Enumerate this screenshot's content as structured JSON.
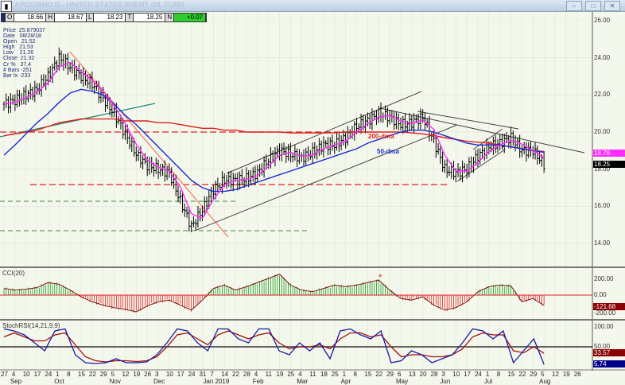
{
  "window": {
    "title": "APCO/BNO.D - UNITED STATES BRENT OIL FUND",
    "buttons": [
      "–",
      "□",
      "✕"
    ]
  },
  "ohlc_bar": {
    "o_label": "O",
    "o": "18.66",
    "h_label": "H",
    "h": "18.67",
    "l_label": "L",
    "l": "18.23",
    "t_label": "T",
    "t": "18.25",
    "n_label": "N",
    "n": "+0.07",
    "change_color": "#2ecc2e"
  },
  "info_panel": [
    "Price  25.879037",
    "Date   08/28/18",
    "Open   21.52",
    "High   21.53",
    "Low    21.26",
    "Close  21.32",
    "Cr %   37.4",
    "# Bars -251",
    "Bar Ix -233"
  ],
  "annotations": {
    "ma200": "200-dma",
    "ma50": "50-dma"
  },
  "price_axis": {
    "labels": [
      "26.00",
      "24.00",
      "22.00",
      "20.00",
      "18.00",
      "16.00",
      "14.00"
    ],
    "tag_ma": "18.78",
    "tag_price": "18.25"
  },
  "cci_panel": {
    "title": "CCI(20)",
    "labels": [
      "200.00",
      "0.00",
      "-200.00"
    ],
    "tag": "-121.68"
  },
  "stoch_panel": {
    "title": "StochRSI(14,21,9,9)",
    "labels": [
      "100.00",
      "50.00"
    ],
    "tag_signal": "33.57",
    "tag_k": "5.74"
  },
  "date_axis": {
    "days": [
      "27",
      "4",
      "10",
      "17",
      "24",
      "1",
      "8",
      "15",
      "22",
      "29",
      "5",
      "12",
      "19",
      "26",
      "3",
      "10",
      "17",
      "24",
      "31",
      "7",
      "14",
      "22",
      "28",
      "4",
      "11",
      "19",
      "25",
      "4",
      "11",
      "18",
      "25",
      "1",
      "8",
      "15",
      "22",
      "29",
      "6",
      "13",
      "20",
      "28",
      "3",
      "10",
      "17",
      "24",
      "1",
      "8",
      "15",
      "22",
      "29",
      "5",
      "12",
      "19",
      "26"
    ],
    "months": [
      {
        "label": "Sep",
        "week": 1
      },
      {
        "label": "Oct",
        "week": 5
      },
      {
        "label": "Nov",
        "week": 10
      },
      {
        "label": "Dec",
        "week": 14
      },
      {
        "label": "Jan 2019",
        "week": 18.5
      },
      {
        "label": "Feb",
        "week": 23
      },
      {
        "label": "Mar",
        "week": 27
      },
      {
        "label": "Apr",
        "week": 31
      },
      {
        "label": "May",
        "week": 36
      },
      {
        "label": "Jun",
        "week": 40
      },
      {
        "label": "Jul",
        "week": 44
      },
      {
        "label": "Aug",
        "week": 49
      }
    ]
  },
  "chart_data": {
    "type": "line",
    "title": "United States Brent Oil Fund (BNO) daily",
    "x_unit": "week index from 2018-08-27",
    "ylim": [
      13,
      26.6
    ],
    "close": [
      21.5,
      21.7,
      22.0,
      22.3,
      23.0,
      24.0,
      23.5,
      23.0,
      22.6,
      21.8,
      21.0,
      19.9,
      18.8,
      18.2,
      18.0,
      17.8,
      16.3,
      14.9,
      15.8,
      16.9,
      17.4,
      17.4,
      17.5,
      17.8,
      18.5,
      19.0,
      18.8,
      18.6,
      18.9,
      19.3,
      19.3,
      19.7,
      20.3,
      20.6,
      21.0,
      20.8,
      20.4,
      20.5,
      20.8,
      19.5,
      18.0,
      17.8,
      18.0,
      18.7,
      19.2,
      19.4,
      19.7,
      19.0,
      19.0,
      18.25
    ],
    "ma50": [
      18.75,
      19.3,
      19.9,
      20.5,
      21.0,
      21.6,
      22.1,
      22.3,
      22.2,
      22.0,
      21.5,
      20.9,
      20.4,
      19.8,
      19.2,
      18.6,
      18.0,
      17.4,
      17.0,
      16.8,
      16.8,
      16.9,
      17.1,
      17.3,
      17.5,
      17.7,
      17.9,
      18.1,
      18.3,
      18.5,
      18.7,
      18.9,
      19.1,
      19.4,
      19.6,
      19.8,
      20.0,
      20.1,
      20.1,
      20.0,
      19.8,
      19.6,
      19.4,
      19.3,
      19.3,
      19.3,
      19.2,
      19.1,
      19.0,
      18.9
    ],
    "ma200": [
      19.8,
      19.9,
      20.0,
      20.1,
      20.3,
      20.5,
      20.6,
      20.7,
      20.7,
      20.7,
      20.7,
      20.6,
      20.6,
      20.6,
      20.5,
      20.5,
      20.4,
      20.3,
      20.2,
      20.2,
      20.1,
      20.1,
      20.0,
      20.0,
      20.0,
      20.0,
      19.95,
      19.95,
      19.95,
      19.95,
      19.95,
      20.0,
      20.0,
      20.0,
      20.0,
      20.0,
      20.0,
      19.95,
      19.9,
      19.8,
      19.7,
      19.6,
      19.5,
      19.45,
      19.4,
      19.3,
      19.2,
      19.1,
      19.0,
      18.95
    ],
    "cci": [
      80,
      60,
      70,
      90,
      150,
      130,
      60,
      -20,
      -80,
      -120,
      -150,
      -170,
      -200,
      -130,
      -80,
      -60,
      -120,
      -180,
      -60,
      80,
      120,
      60,
      100,
      150,
      200,
      250,
      120,
      60,
      40,
      80,
      120,
      100,
      120,
      150,
      180,
      60,
      -40,
      -60,
      -20,
      -120,
      -180,
      -150,
      -80,
      40,
      100,
      120,
      110,
      -80,
      -40,
      -121.68
    ],
    "stoch_k": [
      95,
      90,
      80,
      60,
      40,
      90,
      95,
      30,
      10,
      8,
      10,
      20,
      10,
      10,
      12,
      30,
      60,
      95,
      90,
      60,
      40,
      95,
      95,
      70,
      60,
      95,
      95,
      40,
      30,
      60,
      40,
      60,
      20,
      90,
      95,
      80,
      70,
      90,
      10,
      15,
      40,
      30,
      10,
      20,
      30,
      60,
      95,
      90,
      70,
      90,
      10,
      40,
      70,
      5.74
    ],
    "stoch_d": [
      75,
      85,
      75,
      65,
      65,
      80,
      85,
      55,
      25,
      15,
      12,
      15,
      15,
      13,
      15,
      25,
      50,
      80,
      85,
      70,
      55,
      80,
      90,
      80,
      70,
      80,
      85,
      60,
      45,
      50,
      50,
      55,
      45,
      70,
      85,
      85,
      75,
      80,
      50,
      25,
      30,
      30,
      25,
      25,
      30,
      45,
      75,
      85,
      80,
      80,
      40,
      35,
      50,
      33.57
    ]
  }
}
